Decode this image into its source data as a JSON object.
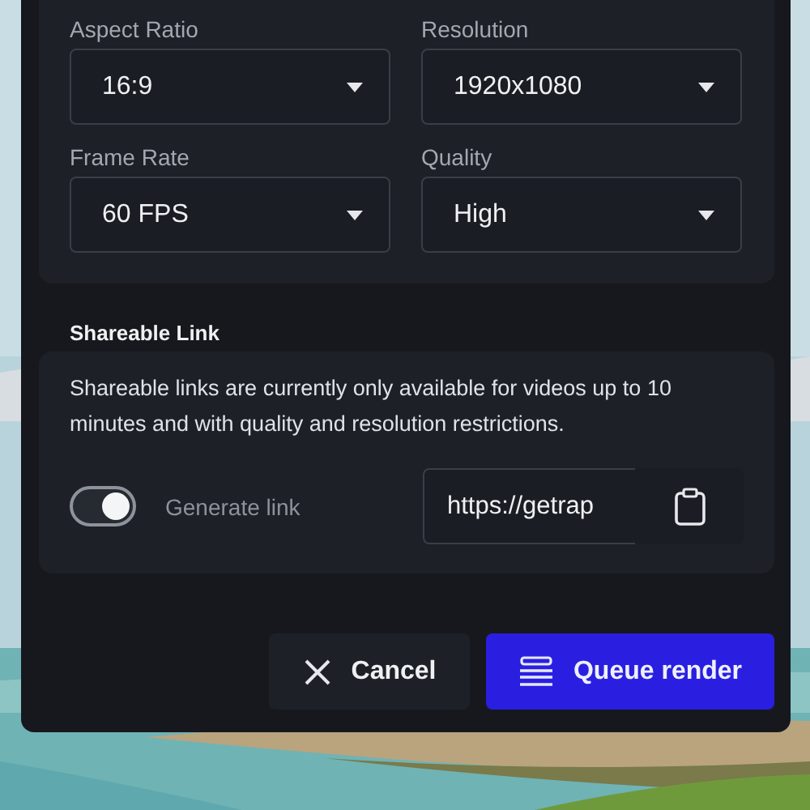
{
  "settings": [
    {
      "label": "Aspect Ratio",
      "value": "16:9"
    },
    {
      "label": "Resolution",
      "value": "1920x1080"
    },
    {
      "label": "Frame Rate",
      "value": "60 FPS"
    },
    {
      "label": "Quality",
      "value": "High"
    }
  ],
  "shareable_link": {
    "title": "Shareable Link",
    "description": "Shareable links are currently only available for videos up to 10 minutes and with quality and resolution restrictions.",
    "toggle": {
      "label": "Generate link",
      "on": true
    },
    "link_value": "https://getrap"
  },
  "buttons": [
    {
      "kind": "cancel",
      "label": "Cancel"
    },
    {
      "kind": "queue",
      "label": "Queue render"
    }
  ]
}
